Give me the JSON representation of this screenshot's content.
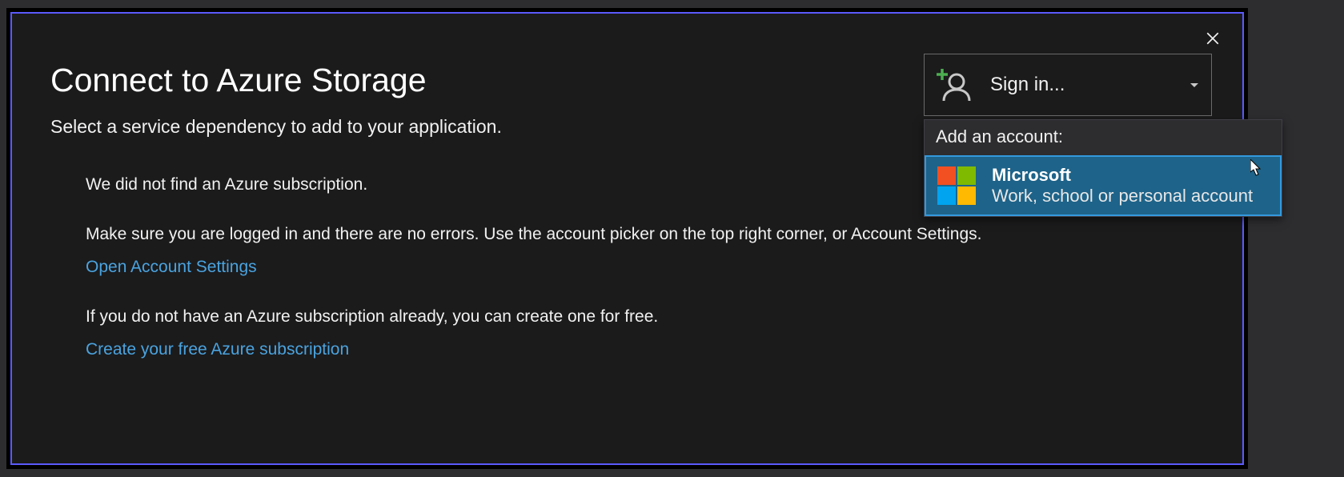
{
  "dialog": {
    "title": "Connect to Azure Storage",
    "subtitle": "Select a service dependency to add to your application."
  },
  "messages": {
    "no_subscription": "We did not find an Azure subscription.",
    "logged_in_hint": "Make sure you are logged in and there are no errors. Use the account picker on the top right corner, or Account Settings.",
    "open_settings_link": "Open Account Settings",
    "no_sub_hint": "If you do not have an Azure subscription already, you can create one for free.",
    "create_free_link": "Create your free Azure subscription"
  },
  "signin": {
    "label": "Sign in..."
  },
  "dropdown": {
    "header": "Add an account:",
    "option": {
      "name": "Microsoft",
      "desc": "Work, school or personal account"
    }
  }
}
